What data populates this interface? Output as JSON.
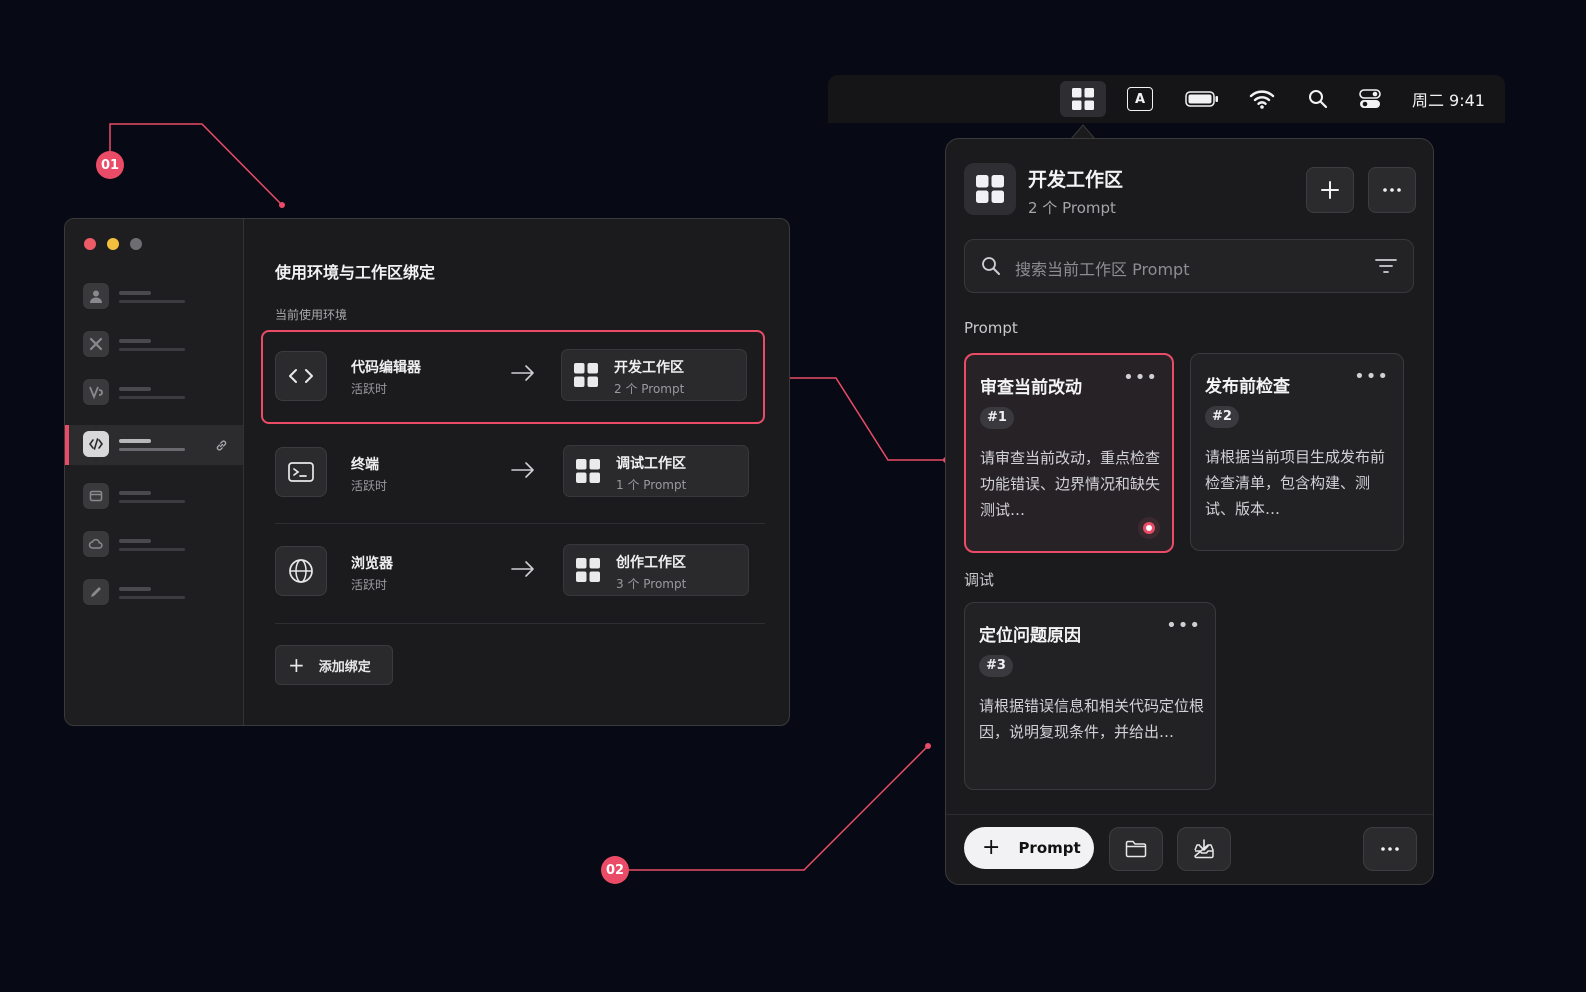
{
  "annotations": {
    "badge_1": "01",
    "badge_2": "02"
  },
  "colors": {
    "accent": "#ea4c67",
    "background": "#070a14",
    "panel": "#1b1b1d"
  },
  "bindings_window": {
    "title": "使用环境与工作区绑定",
    "section_label": "当前使用环境",
    "rows": [
      {
        "env_icon": "code-icon",
        "env_name": "代码编辑器",
        "env_status": "活跃时",
        "workspace_name": "开发工作区",
        "workspace_count": "2 个 Prompt"
      },
      {
        "env_icon": "terminal-icon",
        "env_name": "终端",
        "env_status": "活跃时",
        "workspace_name": "调试工作区",
        "workspace_count": "1 个 Prompt"
      },
      {
        "env_icon": "globe-icon",
        "env_name": "浏览器",
        "env_status": "活跃时",
        "workspace_name": "创作工作区",
        "workspace_count": "3 个 Prompt"
      }
    ],
    "add_button_label": "添加绑定",
    "sidebar_icons": [
      "user-icon",
      "tools-icon",
      "vs-icon",
      "code-slash-icon",
      "window-icon",
      "cloud-icon",
      "pen-icon"
    ]
  },
  "menubar": {
    "icons": [
      "workspace-grid-icon",
      "input-source-a-icon",
      "battery-icon",
      "wifi-icon",
      "search-icon",
      "control-center-icon"
    ],
    "input_letter": "A",
    "clock": "周二 9:41"
  },
  "popover": {
    "title": "开发工作区",
    "subtitle": "2 个 Prompt",
    "search_placeholder": "搜索当前工作区 Prompt",
    "groups": [
      {
        "label": "Prompt",
        "cards": [
          {
            "title": "审查当前改动",
            "tag": "#1",
            "body": "请审查当前改动，重点检查功能错误、边界情况和缺失测试…"
          },
          {
            "title": "发布前检查",
            "tag": "#2",
            "body": "请根据当前项目生成发布前检查清单，包含构建、测试、版本…"
          }
        ]
      },
      {
        "label": "调试",
        "cards": [
          {
            "title": "定位问题原因",
            "tag": "#3",
            "body": "请根据错误信息和相关代码定位根因，说明复现条件，并给出…"
          }
        ]
      }
    ],
    "footer": {
      "add_prompt_label": "Prompt"
    }
  }
}
